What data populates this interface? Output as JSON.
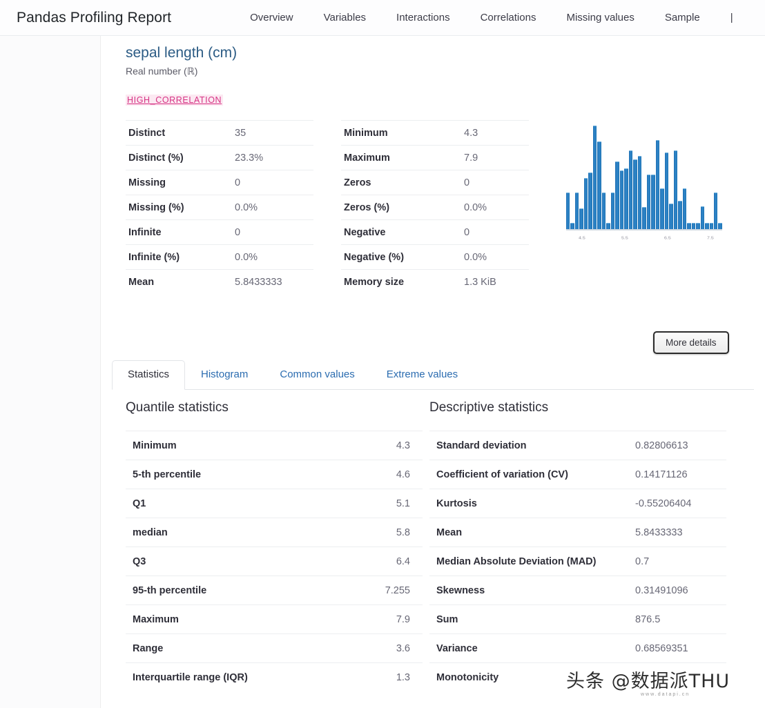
{
  "navbar": {
    "brand": "Pandas Profiling Report",
    "items": [
      {
        "label": "Overview"
      },
      {
        "label": "Variables"
      },
      {
        "label": "Interactions"
      },
      {
        "label": "Correlations"
      },
      {
        "label": "Missing values"
      },
      {
        "label": "Sample"
      },
      {
        "label": "|"
      }
    ]
  },
  "variable": {
    "title": "sepal length (cm)",
    "subtitle": "Real number (ℝ)",
    "badge": "HIGH_CORRELATION",
    "badge_color": "#d63384",
    "stats_left": [
      {
        "key": "Distinct",
        "value": "35"
      },
      {
        "key": "Distinct (%)",
        "value": "23.3%"
      },
      {
        "key": "Missing",
        "value": "0"
      },
      {
        "key": "Missing (%)",
        "value": "0.0%"
      },
      {
        "key": "Infinite",
        "value": "0"
      },
      {
        "key": "Infinite (%)",
        "value": "0.0%"
      },
      {
        "key": "Mean",
        "value": "5.8433333"
      }
    ],
    "stats_right": [
      {
        "key": "Minimum",
        "value": "4.3"
      },
      {
        "key": "Maximum",
        "value": "7.9"
      },
      {
        "key": "Zeros",
        "value": "0"
      },
      {
        "key": "Zeros (%)",
        "value": "0.0%"
      },
      {
        "key": "Negative",
        "value": "0"
      },
      {
        "key": "Negative (%)",
        "value": "0.0%"
      },
      {
        "key": "Memory size",
        "value": "1.3 KiB"
      }
    ]
  },
  "more_details_button": "More details",
  "tabs": [
    {
      "label": "Statistics",
      "active": true
    },
    {
      "label": "Histogram",
      "active": false
    },
    {
      "label": "Common values",
      "active": false
    },
    {
      "label": "Extreme values",
      "active": false
    }
  ],
  "quantile_statistics": {
    "title": "Quantile statistics",
    "rows": [
      {
        "key": "Minimum",
        "value": "4.3"
      },
      {
        "key": "5-th percentile",
        "value": "4.6"
      },
      {
        "key": "Q1",
        "value": "5.1"
      },
      {
        "key": "median",
        "value": "5.8"
      },
      {
        "key": "Q3",
        "value": "6.4"
      },
      {
        "key": "95-th percentile",
        "value": "7.255"
      },
      {
        "key": "Maximum",
        "value": "7.9"
      },
      {
        "key": "Range",
        "value": "3.6"
      },
      {
        "key": "Interquartile range (IQR)",
        "value": "1.3"
      }
    ]
  },
  "descriptive_statistics": {
    "title": "Descriptive statistics",
    "rows": [
      {
        "key": "Standard deviation",
        "value": "0.82806613"
      },
      {
        "key": "Coefficient of variation (CV)",
        "value": "0.14171126"
      },
      {
        "key": "Kurtosis",
        "value": "-0.55206404"
      },
      {
        "key": "Mean",
        "value": "5.8433333"
      },
      {
        "key": "Median Absolute Deviation (MAD)",
        "value": "0.7"
      },
      {
        "key": "Skewness",
        "value": "0.31491096"
      },
      {
        "key": "Sum",
        "value": "876.5"
      },
      {
        "key": "Variance",
        "value": "0.68569351"
      },
      {
        "key": "Monotonicity",
        "value": ""
      }
    ]
  },
  "watermark": {
    "text": "头条 @数据派THU",
    "sub": "www.datapi.cn"
  },
  "chart_data": {
    "type": "bar",
    "title": "",
    "xlabel": "",
    "ylabel": "",
    "grid": false,
    "legend": null,
    "bar_color": "#2176b6",
    "ylim": [
      0,
      10
    ],
    "categories": [
      "4.3",
      "4.4",
      "4.5",
      "4.6",
      "4.7",
      "4.8",
      "4.9",
      "5.0",
      "5.1",
      "5.2",
      "5.3",
      "5.4",
      "5.5",
      "5.6",
      "5.7",
      "5.8",
      "5.9",
      "6.0",
      "6.1",
      "6.2",
      "6.3",
      "6.4",
      "6.5",
      "6.6",
      "6.7",
      "6.8",
      "6.9",
      "7.0",
      "7.1",
      "7.2",
      "7.3",
      "7.4",
      "7.6",
      "7.7",
      "7.9"
    ],
    "values": [
      3.2,
      0.5,
      3.2,
      1.8,
      4.5,
      5.0,
      9.2,
      7.8,
      3.2,
      0.5,
      3.2,
      6.0,
      5.2,
      5.4,
      7.0,
      6.2,
      6.5,
      1.9,
      4.8,
      4.8,
      7.9,
      3.6,
      6.8,
      2.2,
      7.0,
      2.5,
      3.6,
      0.5,
      0.5,
      0.5,
      2.0,
      0.5,
      0.5,
      3.2,
      0.5
    ],
    "x_tick_labels": [
      "4.5",
      "5.5",
      "6.5",
      "7.5"
    ]
  }
}
